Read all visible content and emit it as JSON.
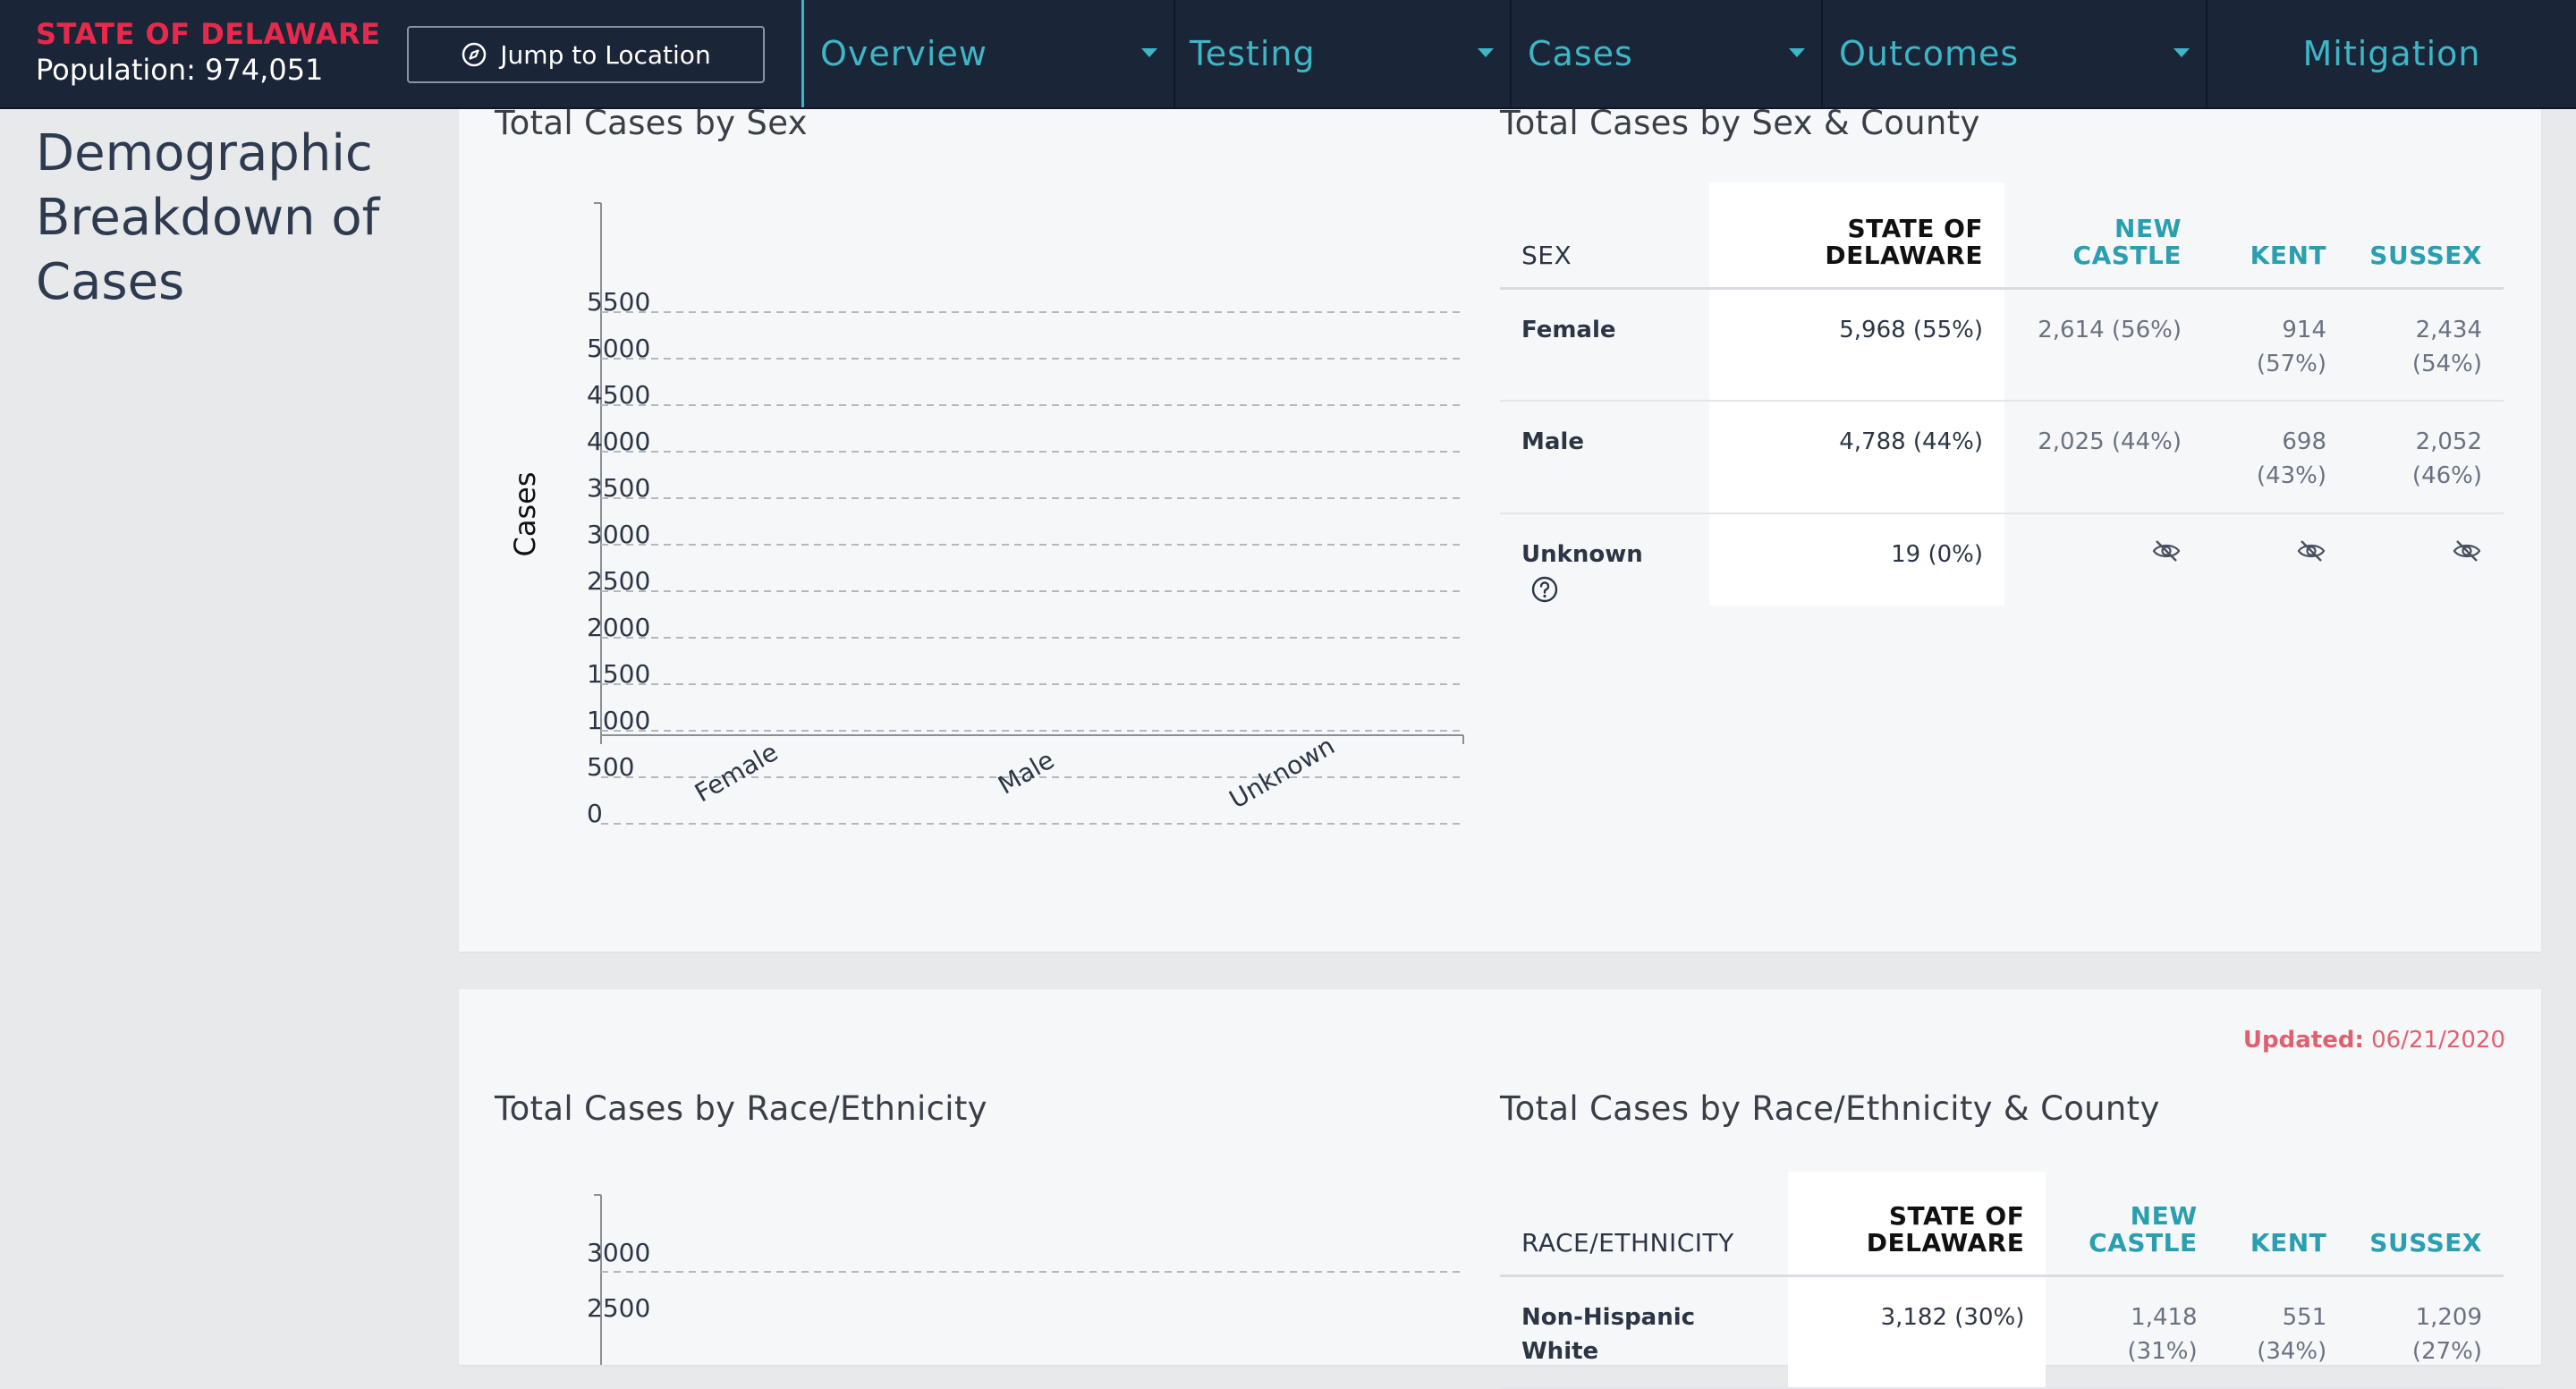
{
  "header": {
    "state": "STATE OF DELAWARE",
    "population": "Population: 974,051",
    "jump_label": "Jump to Location",
    "tabs": [
      "Overview",
      "Testing",
      "Cases",
      "Outcomes",
      "Mitigation"
    ]
  },
  "page_title": "Demographic Breakdown of Cases",
  "sex_section": {
    "chart_title": "Total Cases by Sex",
    "table_title": "Total Cases by Sex & County"
  },
  "sex_table": {
    "columns": [
      "SEX",
      "STATE OF DELAWARE",
      "NEW CASTLE",
      "KENT",
      "SUSSEX"
    ],
    "rows": [
      {
        "label": "Female",
        "state": "5,968 (55%)",
        "new_castle": "2,614 (56%)",
        "kent": "914 (57%)",
        "sussex": "2,434 (54%)"
      },
      {
        "label": "Male",
        "state": "4,788 (44%)",
        "new_castle": "2,025 (44%)",
        "kent": "698 (43%)",
        "sussex": "2,052 (46%)"
      },
      {
        "label": "Unknown",
        "state": "19 (0%)",
        "new_castle": "hidden",
        "kent": "hidden",
        "sussex": "hidden"
      }
    ]
  },
  "race_section": {
    "updated_label": "Updated:",
    "updated_date": "06/21/2020",
    "chart_title": "Total Cases by Race/Ethnicity",
    "table_title": "Total Cases by Race/Ethnicity & County"
  },
  "race_table": {
    "columns": [
      "RACE/ETHNICITY",
      "STATE OF DELAWARE",
      "NEW CASTLE",
      "KENT",
      "SUSSEX"
    ],
    "rows": [
      {
        "label": "Non-Hispanic White",
        "state": "3,182 (30%)",
        "new_castle": "1,418 (31%)",
        "kent": "551 (34%)",
        "sussex": "1,209 (27%)"
      }
    ]
  },
  "chart_data": [
    {
      "type": "bar",
      "title": "Total Cases by Sex",
      "ylabel": "Cases",
      "xlabel": "",
      "categories": [
        "Female",
        "Male",
        "Unknown"
      ],
      "values": [],
      "yticks": [
        0,
        500,
        1000,
        1500,
        2000,
        2500,
        3000,
        3500,
        4000,
        4500,
        5000,
        5500
      ],
      "ylim": [
        0,
        5500
      ],
      "grid": true
    },
    {
      "type": "bar",
      "title": "Total Cases by Race/Ethnicity",
      "yticks": [
        2500,
        3000
      ],
      "grid": true
    }
  ],
  "colors": {
    "nav_bg": "#1b2538",
    "accent": "#3db6c6",
    "brand_red": "#e8294b",
    "county_header": "#2a9fb0"
  }
}
